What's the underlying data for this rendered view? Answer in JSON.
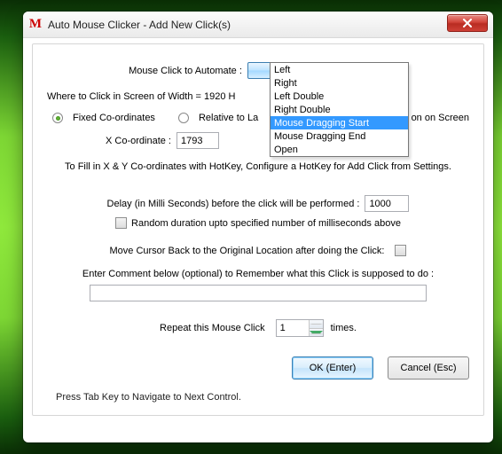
{
  "window": {
    "title": "Auto Mouse Clicker - Add New Click(s)"
  },
  "labels": {
    "automate": "Mouse Click to Automate :",
    "where": "Where to Click in Screen of Width = 1920 H",
    "fixed": "Fixed Co-ordinates",
    "relative": "Relative to La",
    "on_screen": "on on Screen",
    "x_coord": "X Co-ordinate :",
    "hotkey_hint": "To Fill in X & Y Co-ordinates with HotKey, Configure a HotKey for Add Click from Settings.",
    "delay_before": "Delay (in Milli Seconds) before the click will be performed :",
    "random_duration": "Random duration upto specified number of milliseconds above",
    "move_back": "Move Cursor Back to the Original Location after doing the Click:",
    "comment_hint": "Enter Comment below (optional) to Remember what this Click is supposed to do :",
    "repeat_pre": "Repeat this Mouse Click",
    "repeat_post": "times.",
    "tab_hint": "Press Tab Key to Navigate to Next Control."
  },
  "inputs": {
    "x_value": "1793",
    "delay_value": "1000",
    "comment_value": "",
    "repeat_value": "1"
  },
  "dropdown": {
    "items": [
      "Left",
      "Right",
      "Left Double",
      "Right Double",
      "Mouse Dragging Start",
      "Mouse Dragging End",
      "Open"
    ],
    "highlighted_index": 4
  },
  "buttons": {
    "ok": "OK (Enter)",
    "cancel": "Cancel (Esc)"
  }
}
